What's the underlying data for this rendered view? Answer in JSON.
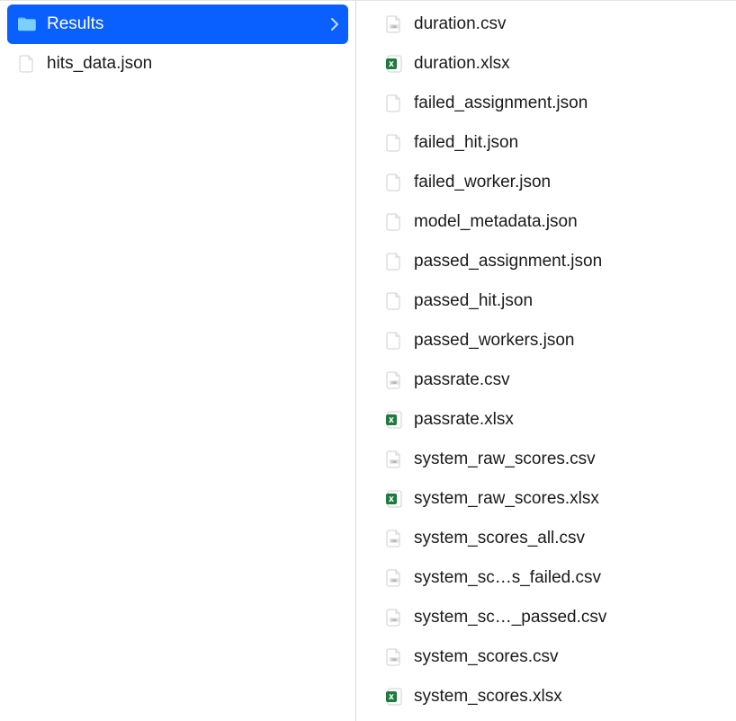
{
  "left": {
    "items": [
      {
        "name": "Results",
        "type": "folder",
        "selected": true,
        "hasChildren": true
      },
      {
        "name": "hits_data.json",
        "type": "blank",
        "selected": false,
        "hasChildren": false
      }
    ]
  },
  "right": {
    "items": [
      {
        "name": "duration.csv",
        "type": "csv"
      },
      {
        "name": "duration.xlsx",
        "type": "xlsx"
      },
      {
        "name": "failed_assignment.json",
        "type": "blank"
      },
      {
        "name": "failed_hit.json",
        "type": "blank"
      },
      {
        "name": "failed_worker.json",
        "type": "blank"
      },
      {
        "name": "model_metadata.json",
        "type": "blank"
      },
      {
        "name": "passed_assignment.json",
        "type": "blank"
      },
      {
        "name": "passed_hit.json",
        "type": "blank"
      },
      {
        "name": "passed_workers.json",
        "type": "blank"
      },
      {
        "name": "passrate.csv",
        "type": "csv"
      },
      {
        "name": "passrate.xlsx",
        "type": "xlsx"
      },
      {
        "name": "system_raw_scores.csv",
        "type": "csv"
      },
      {
        "name": "system_raw_scores.xlsx",
        "type": "xlsx"
      },
      {
        "name": "system_scores_all.csv",
        "type": "csv"
      },
      {
        "name": "system_sc…s_failed.csv",
        "type": "csv"
      },
      {
        "name": "system_sc…_passed.csv",
        "type": "csv"
      },
      {
        "name": "system_scores.csv",
        "type": "csv"
      },
      {
        "name": "system_scores.xlsx",
        "type": "xlsx"
      }
    ]
  }
}
